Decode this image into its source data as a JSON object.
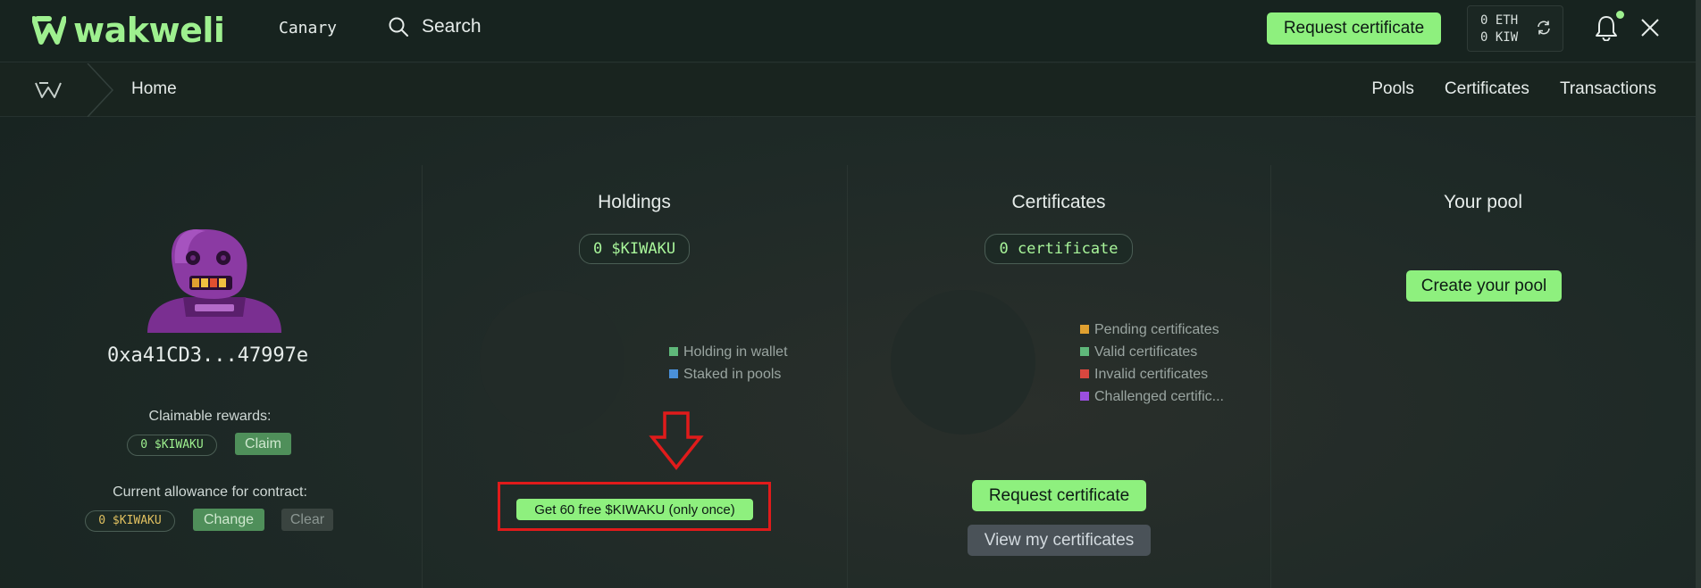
{
  "header": {
    "brand": "wakweli",
    "network": "Canary",
    "search_label": "Search",
    "request_button": "Request certificate",
    "balance_eth": "0 ETH",
    "balance_kiw": "0 KIW"
  },
  "subnav": {
    "breadcrumb_home": "Home",
    "links": [
      "Pools",
      "Certificates",
      "Transactions"
    ]
  },
  "profile": {
    "address": "0xa41CD3...47997e",
    "claimable_label": "Claimable rewards:",
    "claimable_value": "0 $KIWAKU",
    "claim_button": "Claim",
    "allowance_label": "Current allowance for contract:",
    "allowance_value": "0 $KIWAKU",
    "change_button": "Change",
    "clear_button": "Clear"
  },
  "holdings": {
    "title": "Holdings",
    "value": "0 $KIWAKU",
    "legend": [
      {
        "label": "Holding in wallet",
        "color": "#5fb87a"
      },
      {
        "label": "Staked in pools",
        "color": "#4a90d9"
      }
    ],
    "free_button": "Get 60 free $KIWAKU (only once)"
  },
  "certificates": {
    "title": "Certificates",
    "value": "0 certificate",
    "legend": [
      {
        "label": "Pending certificates",
        "color": "#e0a030"
      },
      {
        "label": "Valid certificates",
        "color": "#5fb87a"
      },
      {
        "label": "Invalid certificates",
        "color": "#d9473f"
      },
      {
        "label": "Challenged certific...",
        "color": "#9b4fe0"
      }
    ],
    "request_button": "Request certificate",
    "view_button": "View my certificates"
  },
  "pool": {
    "title": "Your pool",
    "create_button": "Create your pool"
  },
  "colors": {
    "accent": "#8ef07e",
    "highlight": "#e01b1b"
  }
}
